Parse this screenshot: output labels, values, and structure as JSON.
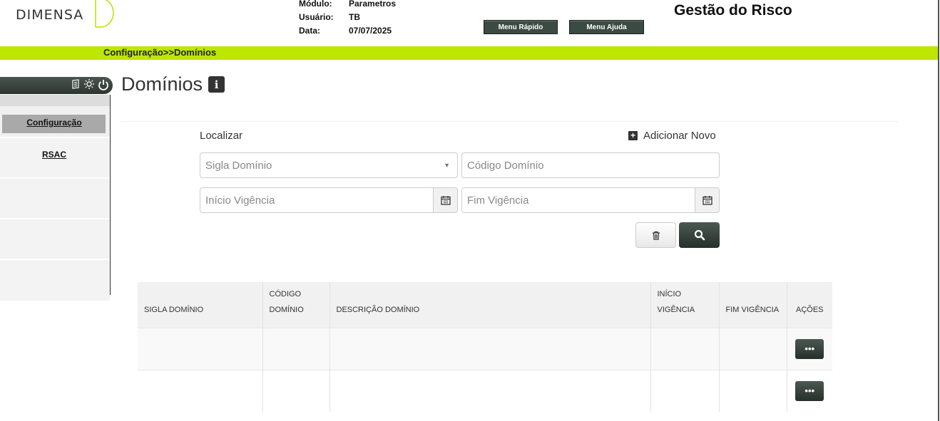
{
  "header": {
    "logo_text": "DIMENSA",
    "info": [
      {
        "key": "Módulo:",
        "value": "Parametros"
      },
      {
        "key": "Usuário:",
        "value": "TB"
      },
      {
        "key": "Data:",
        "value": "07/07/2025"
      }
    ],
    "menu_rapido": "Menu Rápido",
    "menu_ajuda": "Menu Ajuda",
    "app_title": "Gestão do Risco",
    "accent": "#bde600"
  },
  "breadcrumb": "Configuração>>Domínios",
  "sidebar": {
    "items": [
      {
        "label": "Configuração",
        "active": true
      },
      {
        "label": "RSAC",
        "active": false
      }
    ]
  },
  "page": {
    "title": "Domínios",
    "info_badge": "i",
    "localizar": "Localizar",
    "add_new": "Adicionar Novo",
    "fields": {
      "sigla_placeholder": "Sigla Domínio",
      "codigo_placeholder": "Código Domínio",
      "inicio_placeholder": "Início Vigência",
      "fim_placeholder": "Fim Vigência"
    }
  },
  "table": {
    "columns": [
      "SIGLA DOMÍNIO",
      "CÓDIGO DOMÍNIO",
      "DESCRIÇÃO DOMÍNIO",
      "INÍCIO VIGÊNCIA",
      "FIM VIGÊNCIA",
      "AÇÕES"
    ],
    "action_label": "•••"
  }
}
